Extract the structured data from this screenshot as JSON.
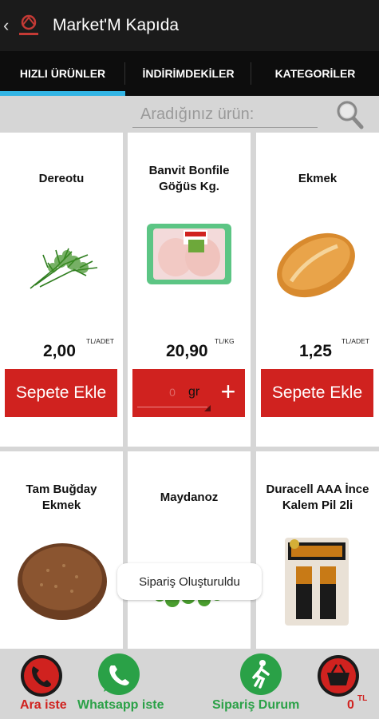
{
  "app": {
    "title": "Market'M Kapıda",
    "back_icon": "back-chevron-icon",
    "logo_icon": "market-logo-icon"
  },
  "tabs": [
    {
      "label": "HIZLI ÜRÜNLER",
      "active": true
    },
    {
      "label": "İNDİRİMDEKİLER",
      "active": false
    },
    {
      "label": "KATEGORİLER",
      "active": false
    }
  ],
  "search": {
    "placeholder": "Aradığınız ürün:",
    "icon": "search-icon"
  },
  "products": [
    {
      "name": "Dereotu",
      "price": "2,00",
      "unit": "TL/ADET",
      "action": "Sepete Ekle"
    },
    {
      "name": "Banvit Bonfile Göğüs Kg.",
      "price": "20,90",
      "unit": "TL/KG",
      "stepper_value": "0",
      "stepper_unit": "gr",
      "stepper_plus": "+"
    },
    {
      "name": "Ekmek",
      "price": "1,25",
      "unit": "TL/ADET",
      "action": "Sepete Ekle"
    },
    {
      "name": "Tam Buğday Ekmek"
    },
    {
      "name": "Maydanoz"
    },
    {
      "name": "Duracell AAA İnce Kalem Pil 2li"
    }
  ],
  "toast": "Sipariş Oluşturuldu",
  "bottom_bar": {
    "call": {
      "label": "Ara iste",
      "icon": "phone-icon"
    },
    "whatsapp": {
      "label": "Whatsapp iste",
      "icon": "whatsapp-icon"
    },
    "order_status": {
      "label": "Sipariş Durum",
      "icon": "walking-person-icon"
    },
    "cart": {
      "amount": "0",
      "currency": "TL",
      "icon": "basket-icon"
    }
  },
  "colors": {
    "accent_blue": "#33b5e5",
    "button_red": "#d0221f",
    "label_green": "#2aa147",
    "appbar_black": "#1b1b1b"
  }
}
